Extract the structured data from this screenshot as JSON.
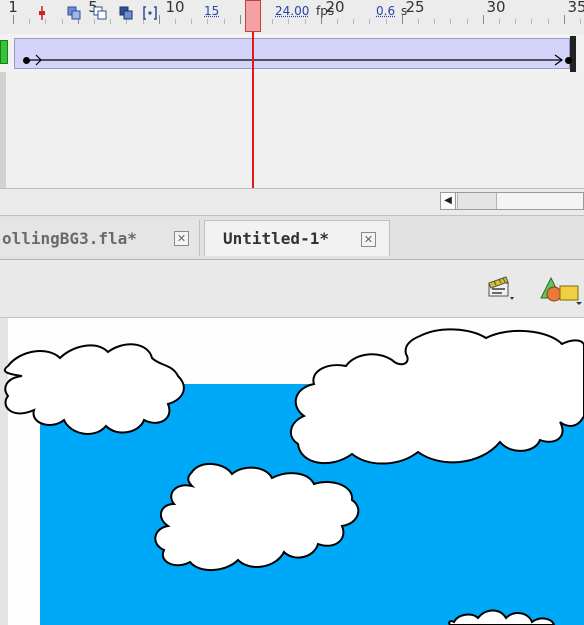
{
  "timeline": {
    "frame_numbers": [
      "1",
      "5",
      "10",
      "15",
      "20",
      "25",
      "30",
      "35"
    ],
    "current_frame": "15",
    "frame_rate": "24.00",
    "frame_rate_unit": "fps",
    "elapsed_time": "0.6",
    "elapsed_time_unit": "s"
  },
  "tabs": [
    {
      "label": "ollingBG3.fla*",
      "active": false
    },
    {
      "label": "Untitled-1*",
      "active": true
    }
  ],
  "icons": {
    "onion_skin": "onion-skin-icon",
    "onion_outlines": "onion-skin-outlines-icon",
    "edit_multiple": "edit-multiple-frames-icon",
    "onion_markers": "onion-markers-icon",
    "center_frame": "center-frame-icon",
    "edit_scene": "edit-scene-icon",
    "edit_symbols": "edit-symbols-icon",
    "tab_close": "close-icon",
    "scroll_left": "scroll-left-arrow-icon"
  },
  "colors": {
    "stage_background": "#00a8f8",
    "cloud_fill": "#ffffff",
    "tween_span": "#d4d4fa",
    "playhead": "#e21919",
    "keyframe": "#34c534"
  }
}
